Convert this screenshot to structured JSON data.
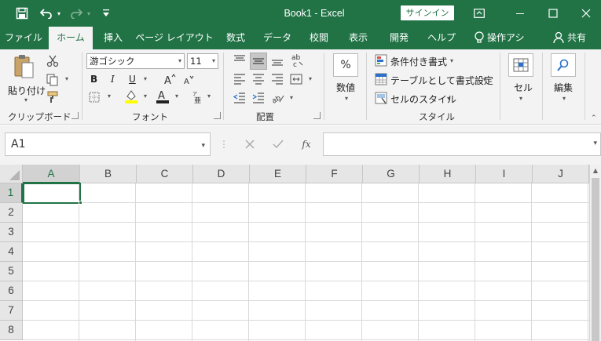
{
  "title_bar": {
    "document_title": "Book1  -  Excel",
    "signin_label": "サインイン",
    "save_icon": "save-icon",
    "undo_icon": "undo-icon",
    "redo_icon": "redo-icon"
  },
  "tabs": [
    {
      "label": "ファイル",
      "active": false
    },
    {
      "label": "ホーム",
      "active": true
    },
    {
      "label": "挿入",
      "active": false
    },
    {
      "label": "ページ レイアウト",
      "active": false
    },
    {
      "label": "数式",
      "active": false
    },
    {
      "label": "データ",
      "active": false
    },
    {
      "label": "校閲",
      "active": false
    },
    {
      "label": "表示",
      "active": false
    },
    {
      "label": "開発",
      "active": false
    },
    {
      "label": "ヘルプ",
      "active": false
    },
    {
      "label": "操作アシ",
      "active": false
    },
    {
      "label": "共有",
      "active": false
    }
  ],
  "ribbon": {
    "clipboard": {
      "paste_label": "貼り付け",
      "group_label": "クリップボード"
    },
    "font": {
      "font_name": "游ゴシック",
      "font_size": "11",
      "group_label": "フォント",
      "bold": "B",
      "italic": "I",
      "underline": "U"
    },
    "alignment": {
      "group_label": "配置"
    },
    "number": {
      "label": "数値",
      "symbol": "%"
    },
    "styles": {
      "conditional_label": "条件付き書式",
      "table_label": "テーブルとして書式設定",
      "cell_styles_label": "セルのスタイル",
      "group_label": "スタイル"
    },
    "cells": {
      "label": "セル"
    },
    "editing": {
      "label": "編集"
    }
  },
  "formula_bar": {
    "name_box": "A1",
    "formula_value": "",
    "fx_label": "fx"
  },
  "grid": {
    "columns": [
      "A",
      "B",
      "C",
      "D",
      "E",
      "F",
      "G",
      "H",
      "I",
      "J"
    ],
    "rows": [
      "1",
      "2",
      "3",
      "4",
      "5",
      "6",
      "7",
      "8"
    ],
    "selected_cell": "A1",
    "accent_color": "#217346"
  },
  "theme": {
    "brand": "#217346",
    "ribbon_bg": "#f3f3f3"
  }
}
